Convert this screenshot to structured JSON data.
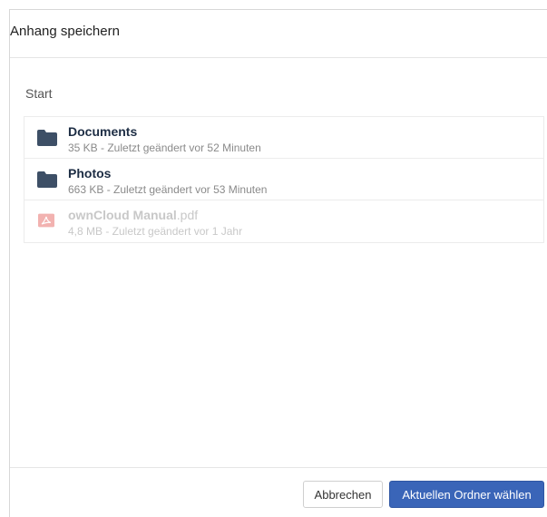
{
  "dialog": {
    "title": "Anhang speichern"
  },
  "breadcrumb": {
    "root": "Start"
  },
  "files": [
    {
      "name": "Documents",
      "ext": "",
      "meta": "35 KB - Zuletzt geändert vor 52 Minuten",
      "icon": "folder-icon",
      "disabled": false
    },
    {
      "name": "Photos",
      "ext": "",
      "meta": "663 KB - Zuletzt geändert vor 53 Minuten",
      "icon": "folder-icon",
      "disabled": false
    },
    {
      "name": "ownCloud Manual",
      "ext": ".pdf",
      "meta": "4,8 MB - Zuletzt geändert vor 1 Jahr",
      "icon": "pdf-file-icon",
      "disabled": true
    }
  ],
  "footer": {
    "cancel_label": "Abbrechen",
    "choose_label": "Aktuellen Ordner wählen"
  },
  "colors": {
    "folder": "#3d4f66",
    "pdf": "#f2b2b0",
    "primary": "#3a65b8"
  }
}
